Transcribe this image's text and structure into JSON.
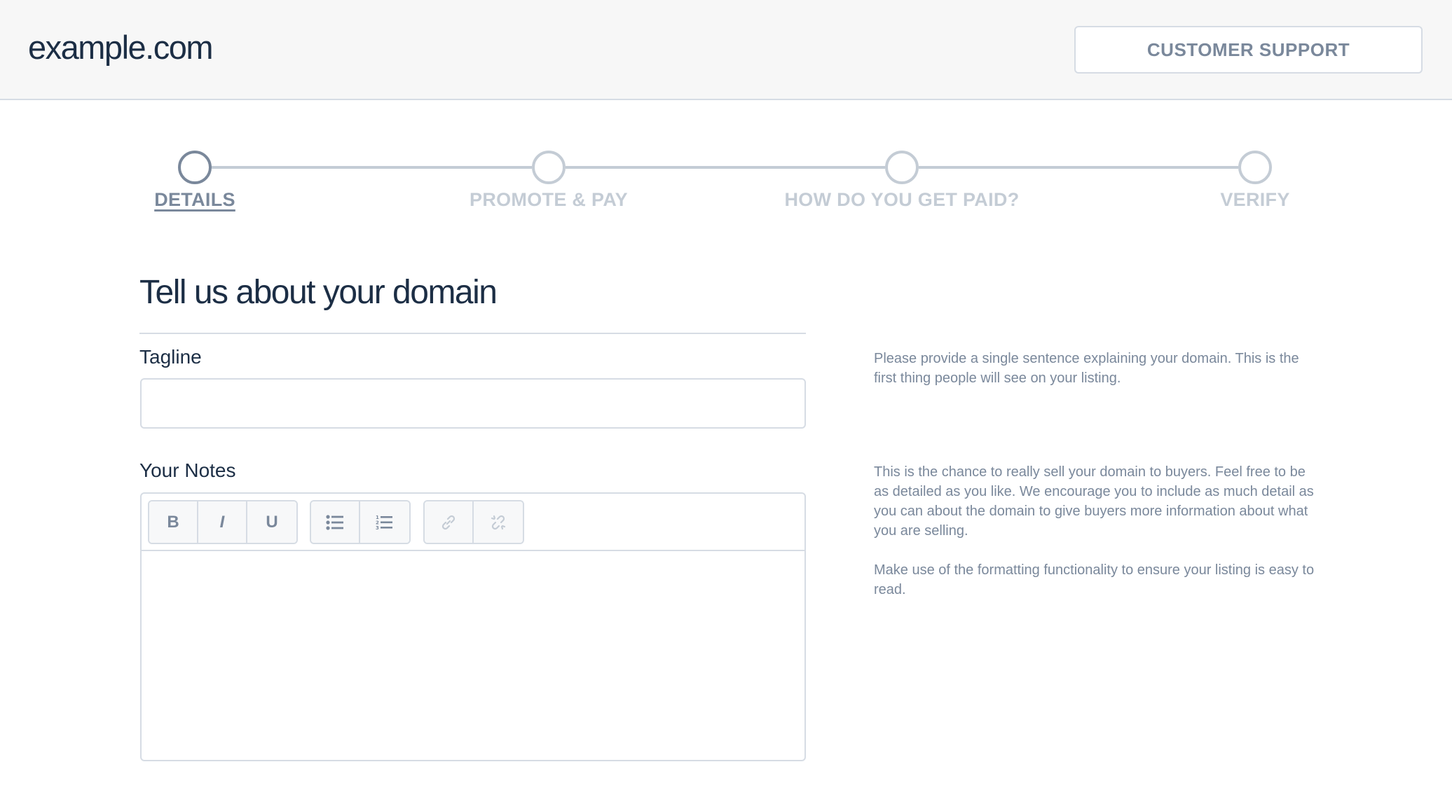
{
  "header": {
    "logo": "example.com",
    "support_button": "CUSTOMER SUPPORT"
  },
  "stepper": {
    "current_step": 1,
    "steps": [
      {
        "label": "DETAILS",
        "active": true
      },
      {
        "label": "PROMOTE & PAY",
        "active": false
      },
      {
        "label": "HOW DO YOU GET PAID?",
        "active": false
      },
      {
        "label": "VERIFY",
        "active": false
      }
    ]
  },
  "form": {
    "title": "Tell us about your domain",
    "tagline": {
      "label": "Tagline",
      "value": "",
      "placeholder": "",
      "help": "Please provide a single sentence explaining your domain. This is the first thing people will see on your listing."
    },
    "notes": {
      "label": "Your Notes",
      "value": "",
      "toolbar": {
        "bold": "B",
        "italic": "I",
        "underline": "U",
        "bullet_list_icon": "bulleted-list-icon",
        "numbered_list_icon": "numbered-list-icon",
        "link_icon": "link-icon",
        "unlink_icon": "unlink-icon"
      },
      "help": [
        "This is the chance to really sell your domain to buyers. Feel free to be as detailed as you like. We encourage you to include as much detail as you can about the domain to give buyers more information about what you are selling.",
        "Make use of the formatting functionality to ensure your listing is easy to read."
      ]
    }
  },
  "colors": {
    "primary_text": "#1c2e45",
    "muted": "#7a889b",
    "inactive": "#c4ccd5",
    "border": "#d6dce4",
    "header_bg": "#f7f7f7"
  }
}
